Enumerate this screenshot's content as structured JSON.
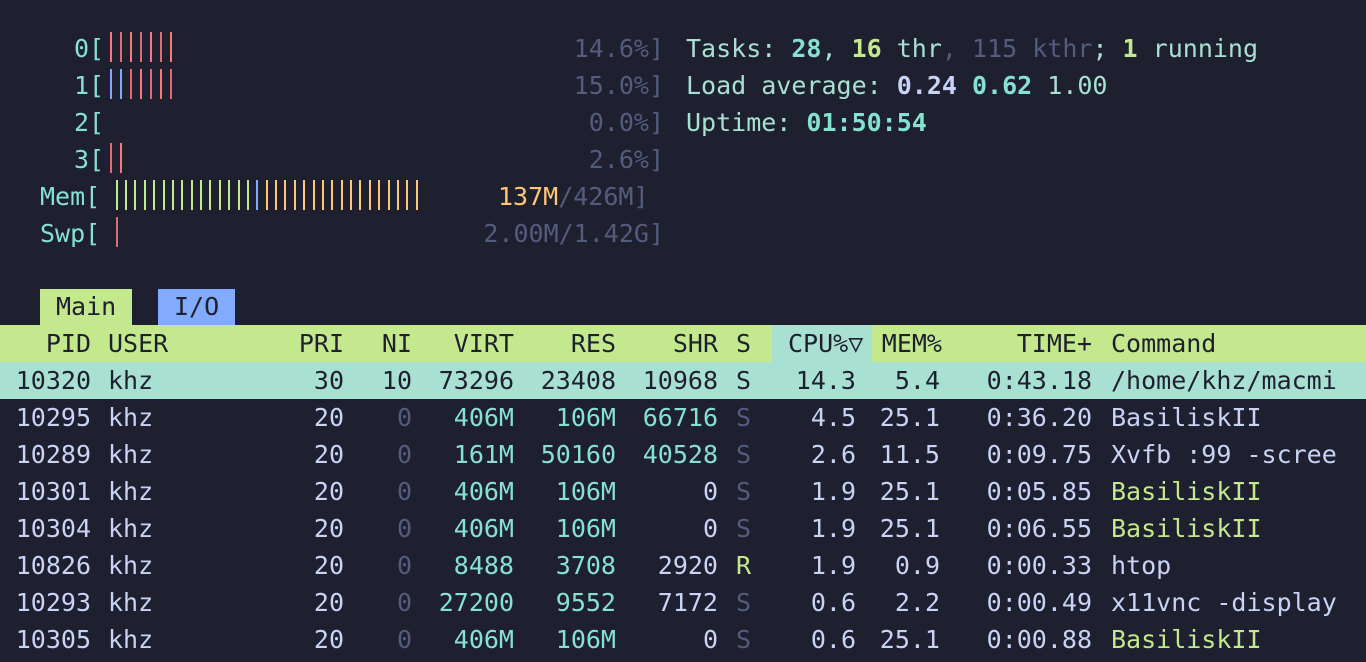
{
  "cpus": [
    {
      "label": "0[",
      "pct": "14.6%]",
      "bars": [
        "red",
        "pink",
        "red",
        "pink",
        "red",
        "pink",
        "red"
      ]
    },
    {
      "label": "1[",
      "pct": "15.0%]",
      "bars": [
        "blue",
        "blue",
        "pink",
        "red",
        "pink",
        "red",
        "pink"
      ]
    },
    {
      "label": "2[",
      "pct": "0.0%]",
      "bars": []
    },
    {
      "label": "3[",
      "pct": "2.6%]",
      "bars": [
        "pink",
        "red"
      ]
    }
  ],
  "mem": {
    "label": "Mem[",
    "used": "137M",
    "total": "/426M]"
  },
  "swp": {
    "label": "Swp[",
    "value": "2.00M/1.42G]"
  },
  "summary": {
    "tasks_label": "Tasks: ",
    "tasks": "28",
    "sep1": ", ",
    "thr": "16",
    "thr_label": " thr",
    "sep2": ", ",
    "kthr": "115 kthr",
    "sep3": "; ",
    "running": "1",
    "running_label": " running",
    "load_label": "Load average: ",
    "load1": "0.24",
    "load5": "0.62",
    "load15": "1.00",
    "uptime_label": "Uptime: ",
    "uptime": "01:50:54"
  },
  "tabs": [
    "Main",
    "I/O"
  ],
  "columns": [
    "PID",
    "USER",
    "PRI",
    "NI",
    "VIRT",
    "RES",
    "SHR",
    "S",
    "CPU%▽",
    "MEM%",
    "TIME+",
    "Command"
  ],
  "processes": [
    {
      "pid": "10320",
      "user": "khz",
      "pri": "30",
      "ni": "10",
      "virt": "73296",
      "res": "23408",
      "shr": "10968",
      "s": "S",
      "cpu": "14.3",
      "mem": "5.4",
      "time": "0:43.18",
      "cmd": "/home/khz/macmi",
      "thread": false
    },
    {
      "pid": "10295",
      "user": "khz",
      "pri": "20",
      "ni": "0",
      "virt": "406M",
      "res": "106M",
      "shr": "66716",
      "s": "S",
      "cpu": "4.5",
      "mem": "25.1",
      "time": "0:36.20",
      "cmd": "BasiliskII",
      "thread": false
    },
    {
      "pid": "10289",
      "user": "khz",
      "pri": "20",
      "ni": "0",
      "virt": "161M",
      "res": "50160",
      "shr": "40528",
      "s": "S",
      "cpu": "2.6",
      "mem": "11.5",
      "time": "0:09.75",
      "cmd": "Xvfb :99 -scree",
      "thread": false
    },
    {
      "pid": "10301",
      "user": "khz",
      "pri": "20",
      "ni": "0",
      "virt": "406M",
      "res": "106M",
      "shr": "0",
      "s": "S",
      "cpu": "1.9",
      "mem": "25.1",
      "time": "0:05.85",
      "cmd": "BasiliskII",
      "thread": true
    },
    {
      "pid": "10304",
      "user": "khz",
      "pri": "20",
      "ni": "0",
      "virt": "406M",
      "res": "106M",
      "shr": "0",
      "s": "S",
      "cpu": "1.9",
      "mem": "25.1",
      "time": "0:06.55",
      "cmd": "BasiliskII",
      "thread": true
    },
    {
      "pid": "10826",
      "user": "khz",
      "pri": "20",
      "ni": "0",
      "virt": "8488",
      "res": "3708",
      "shr": "2920",
      "s": "R",
      "cpu": "1.9",
      "mem": "0.9",
      "time": "0:00.33",
      "cmd": "htop",
      "thread": false
    },
    {
      "pid": "10293",
      "user": "khz",
      "pri": "20",
      "ni": "0",
      "virt": "27200",
      "res": "9552",
      "shr": "7172",
      "s": "S",
      "cpu": "0.6",
      "mem": "2.2",
      "time": "0:00.49",
      "cmd": "x11vnc -display",
      "thread": false
    },
    {
      "pid": "10305",
      "user": "khz",
      "pri": "20",
      "ni": "0",
      "virt": "406M",
      "res": "106M",
      "shr": "0",
      "s": "S",
      "cpu": "0.6",
      "mem": "25.1",
      "time": "0:00.88",
      "cmd": "BasiliskII",
      "thread": true
    }
  ],
  "colors": {
    "background": "#1e2030",
    "header": "#c3e88d",
    "selected": "#a8e0d2",
    "tab_inactive": "#82aaff"
  }
}
